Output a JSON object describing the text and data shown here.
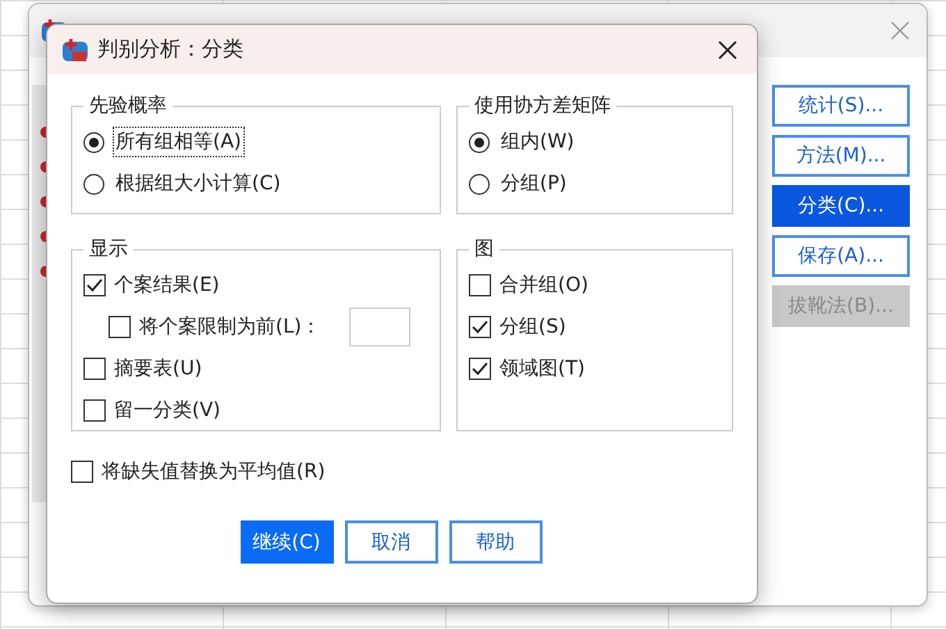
{
  "parent_window": {
    "buttons": [
      {
        "label": "统计(S)...",
        "selected": false,
        "disabled": false
      },
      {
        "label": "方法(M)...",
        "selected": false,
        "disabled": false
      },
      {
        "label": "分类(C)...",
        "selected": true,
        "disabled": false
      },
      {
        "label": "保存(A)...",
        "selected": false,
        "disabled": false
      },
      {
        "label": "拔靴法(B)...",
        "selected": false,
        "disabled": true
      }
    ]
  },
  "dialog": {
    "title": "判别分析：分类"
  },
  "prior_probabilities": {
    "title": "先验概率",
    "options": [
      {
        "label": "所有组相等(A)",
        "selected": true,
        "focused": true
      },
      {
        "label": "根据组大小计算(C)",
        "selected": false,
        "focused": false
      }
    ]
  },
  "covariance_matrix": {
    "title": "使用协方差矩阵",
    "options": [
      {
        "label": "组内(W)",
        "selected": true,
        "focused": false
      },
      {
        "label": "分组(P)",
        "selected": false,
        "focused": false
      }
    ]
  },
  "display": {
    "title": "显示",
    "items": [
      {
        "kind": "checkbox",
        "label": "个案结果(E)",
        "checked": true
      },
      {
        "kind": "limit",
        "label": "将个案限制为前(L)：",
        "checked": false
      },
      {
        "kind": "checkbox",
        "label": "摘要表(U)",
        "checked": false
      },
      {
        "kind": "checkbox",
        "label": "留一分类(V)",
        "checked": false
      }
    ]
  },
  "plots": {
    "title": "图",
    "items": [
      {
        "label": "合并组(O)",
        "checked": false
      },
      {
        "label": "分组(S)",
        "checked": true
      },
      {
        "label": "领域图(T)",
        "checked": true
      }
    ]
  },
  "replace_missing": {
    "label": "将缺失值替换为平均值(R)",
    "checked": false
  },
  "buttons": [
    {
      "label": "继续(C)",
      "primary": true
    },
    {
      "label": "取消",
      "primary": false
    },
    {
      "label": "帮助",
      "primary": false
    }
  ]
}
